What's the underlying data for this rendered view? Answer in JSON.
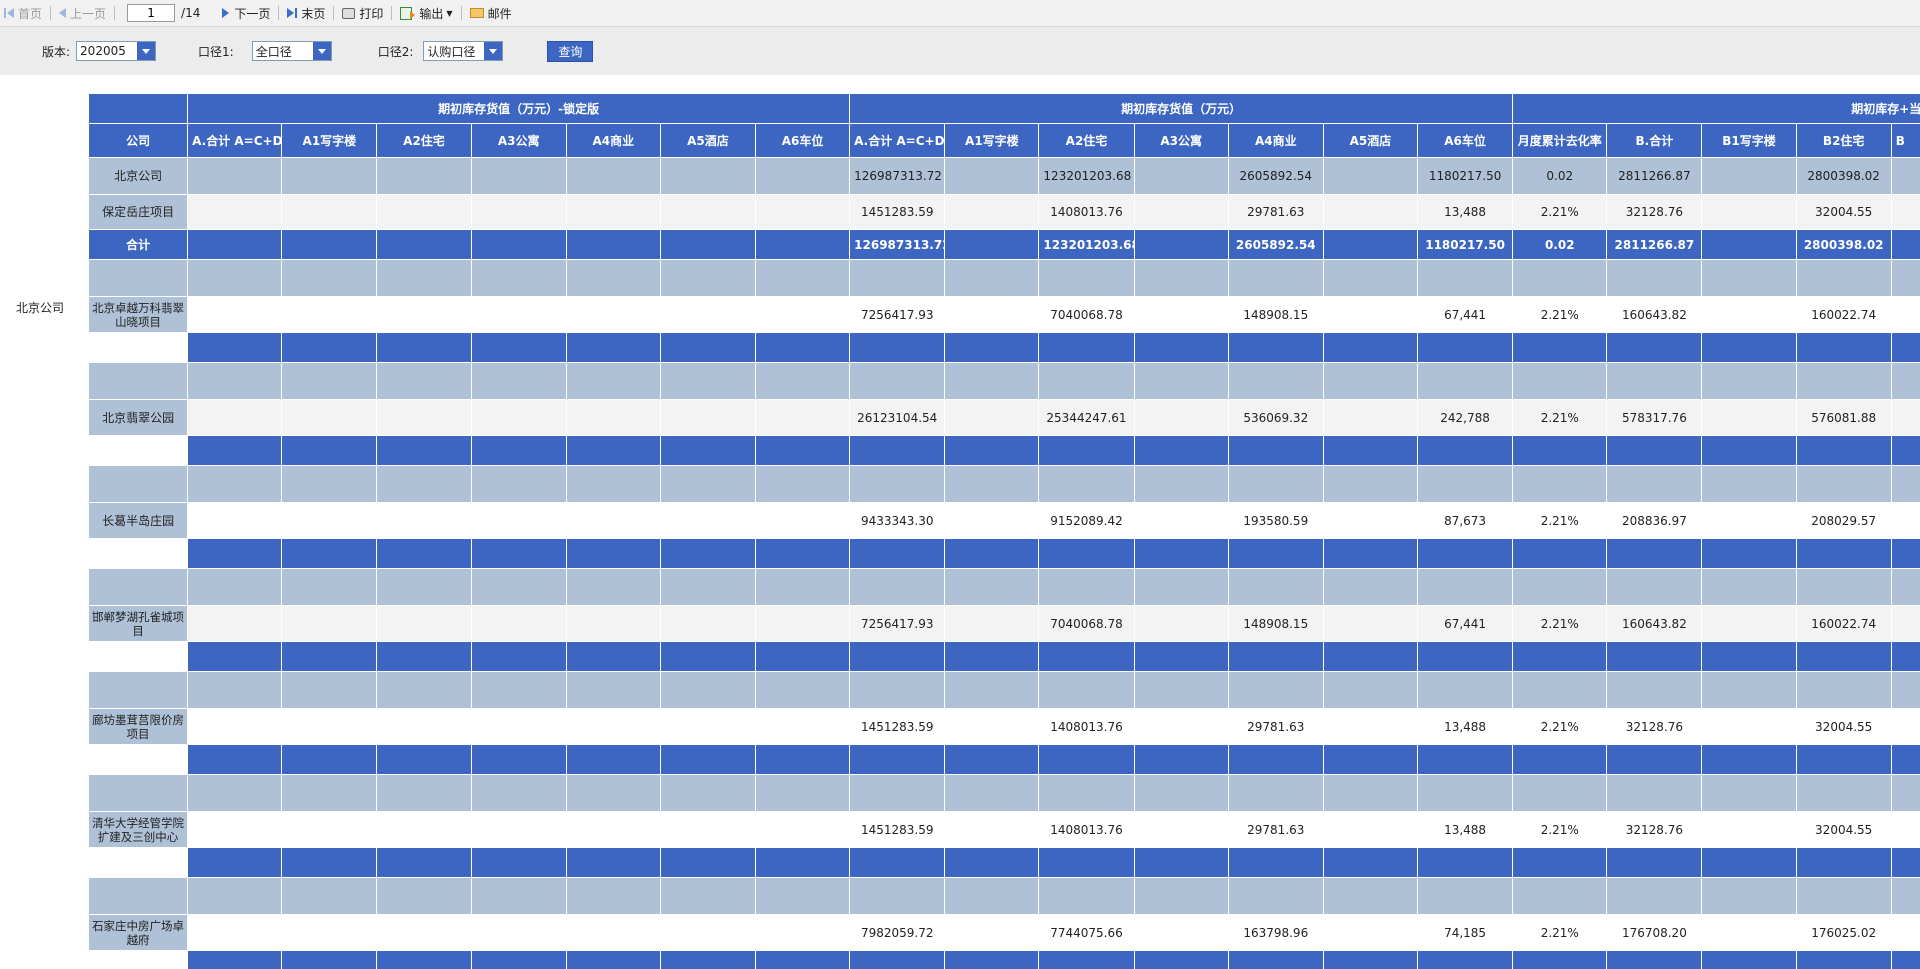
{
  "toolbar": {
    "first": "首页",
    "prev": "上一页",
    "page": "1",
    "total": "/14",
    "next": "下一页",
    "last": "末页",
    "print": "打印",
    "export": "输出",
    "mail": "邮件"
  },
  "filters": {
    "version_label": "版本:",
    "version_value": "202005",
    "scope1_label": "口径1:",
    "scope1_value": "全口径",
    "scope2_label": "口径2:",
    "scope2_value": "认购口径",
    "query": "查询"
  },
  "side_label": "北京公司",
  "groups": {
    "g1": "期初库存货值（万元）-锁定版",
    "g2": "期初库存货值（万元）",
    "g3": "期初库存+当月"
  },
  "headers": {
    "company": "公司",
    "a_total": "A.合计 A=C+D",
    "a1": "A1写字楼",
    "a2": "A2住宅",
    "a3": "A3公寓",
    "a4": "A4商业",
    "a5": "A5酒店",
    "a6": "A6车位",
    "rate": "月度累计去化率",
    "b_total": "B.合计",
    "b1": "B1写字楼",
    "b2": "B2住宅",
    "bcut": "B"
  },
  "rows": {
    "r1": {
      "name": "北京公司",
      "a_total": "126987313.72",
      "a2": "123201203.68",
      "a4": "2605892.54",
      "a6": "1180217.50",
      "rate": "0.02",
      "b_total": "2811266.87",
      "b2": "2800398.02"
    },
    "r2": {
      "name": "保定岳庄项目",
      "a_total": "1451283.59",
      "a2": "1408013.76",
      "a4": "29781.63",
      "a6": "13,488",
      "rate": "2.21%",
      "b_total": "32128.76",
      "b2": "32004.55"
    },
    "total": {
      "name": "合计",
      "a_total": "126987313.72",
      "a2": "123201203.68",
      "a4": "2605892.54",
      "a6": "1180217.50",
      "rate": "0.02",
      "b_total": "2811266.87",
      "b2": "2800398.02"
    },
    "p1": {
      "name": "北京卓越万科翡翠山晓项目",
      "a_total": "7256417.93",
      "a2": "7040068.78",
      "a4": "148908.15",
      "a6": "67,441",
      "rate": "2.21%",
      "b_total": "160643.82",
      "b2": "160022.74"
    },
    "p2": {
      "name": "北京翡翠公园",
      "a_total": "26123104.54",
      "a2": "25344247.61",
      "a4": "536069.32",
      "a6": "242,788",
      "rate": "2.21%",
      "b_total": "578317.76",
      "b2": "576081.88"
    },
    "p3": {
      "name": "长葛半岛庄园",
      "a_total": "9433343.30",
      "a2": "9152089.42",
      "a4": "193580.59",
      "a6": "87,673",
      "rate": "2.21%",
      "b_total": "208836.97",
      "b2": "208029.57"
    },
    "p4": {
      "name": "邯郸梦湖孔雀城项目",
      "a_total": "7256417.93",
      "a2": "7040068.78",
      "a4": "148908.15",
      "a6": "67,441",
      "rate": "2.21%",
      "b_total": "160643.82",
      "b2": "160022.74"
    },
    "p5": {
      "name": "廊坊墨茸莒限价房项目",
      "a_total": "1451283.59",
      "a2": "1408013.76",
      "a4": "29781.63",
      "a6": "13,488",
      "rate": "2.21%",
      "b_total": "32128.76",
      "b2": "32004.55"
    },
    "p6": {
      "name": "清华大学经管学院扩建及三创中心",
      "a_total": "1451283.59",
      "a2": "1408013.76",
      "a4": "29781.63",
      "a6": "13,488",
      "rate": "2.21%",
      "b_total": "32128.76",
      "b2": "32004.55"
    },
    "p7": {
      "name": "石家庄中房广场卓越府",
      "a_total": "7982059.72",
      "a2": "7744075.66",
      "a4": "163798.96",
      "a6": "74,185",
      "rate": "2.21%",
      "b_total": "176708.20",
      "b2": "176025.02"
    }
  },
  "colors": {
    "header_blue": "#3c66c1",
    "light_blue": "#aec1d6",
    "row_gray": "#f3f3f3"
  }
}
